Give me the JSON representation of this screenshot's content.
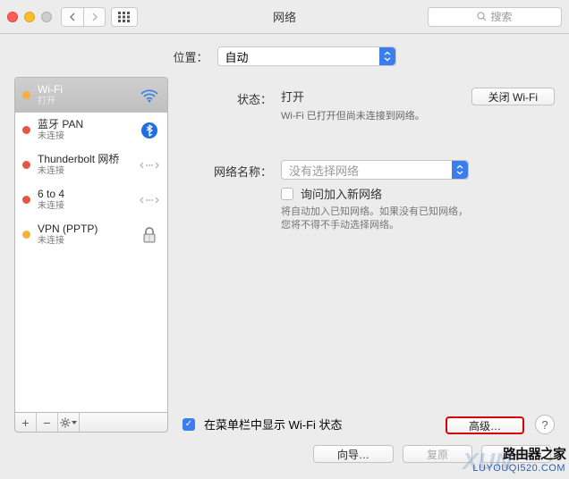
{
  "window": {
    "title": "网络",
    "search_placeholder": "搜索"
  },
  "location": {
    "label": "位置：",
    "value": "自动"
  },
  "services": [
    {
      "name": "Wi-Fi",
      "status": "打开",
      "dot": "yellow",
      "icon": "wifi",
      "selected": true
    },
    {
      "name": "蓝牙 PAN",
      "status": "未连接",
      "dot": "red",
      "icon": "bluetooth",
      "selected": false
    },
    {
      "name": "Thunderbolt 网桥",
      "status": "未连接",
      "dot": "red",
      "icon": "bridge",
      "selected": false
    },
    {
      "name": "6 to 4",
      "status": "未连接",
      "dot": "red",
      "icon": "bridge",
      "selected": false
    },
    {
      "name": "VPN (PPTP)",
      "status": "未连接",
      "dot": "yellow",
      "icon": "lock",
      "selected": false
    }
  ],
  "detail": {
    "status_label": "状态：",
    "status_value": "打开",
    "toggle_button": "关闭 Wi-Fi",
    "status_desc": "Wi-Fi 已打开但尚未连接到网络。",
    "network_name_label": "网络名称：",
    "network_name_value": "没有选择网络",
    "ask_join_label": "询问加入新网络",
    "ask_join_hint": "将自动加入已知网络。如果没有已知网络，您将不得不手动选择网络。",
    "show_menubar_label": "在菜单栏中显示 Wi-Fi 状态",
    "advanced_button": "高级…",
    "help": "?"
  },
  "footer": {
    "assist": "向导…",
    "revert": "复原",
    "apply": "应用"
  },
  "watermark": {
    "line1": "路由器之家",
    "line2": "LUYOUQI520.COM",
    "bg": "XUN"
  }
}
